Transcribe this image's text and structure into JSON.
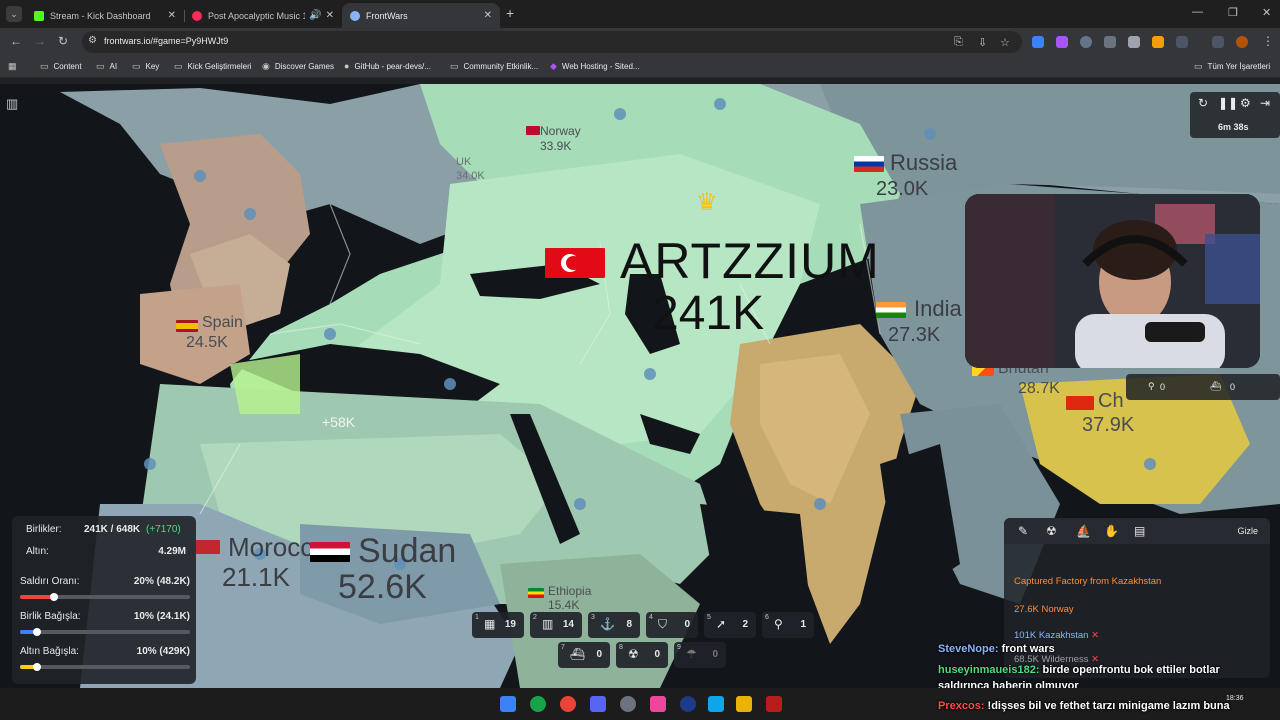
{
  "browser": {
    "tabs": [
      {
        "title": "Stream - Kick Dashboard",
        "color": "#53fc18"
      },
      {
        "title": "Post Apocalyptic Music 10 |",
        "color": "#ff2a55"
      },
      {
        "title": "FrontWars",
        "color": "#8ab4f8"
      }
    ],
    "url": "frontwars.io/#game=Py9HWJt9",
    "bookmarks": [
      {
        "label": "Content",
        "icon": "folder-icon"
      },
      {
        "label": "AI",
        "icon": "folder-icon"
      },
      {
        "label": "Key",
        "icon": "folder-icon"
      },
      {
        "label": "Kick Geliştirmeleri",
        "icon": "folder-icon"
      },
      {
        "label": "Discover Games",
        "icon": "games-icon"
      },
      {
        "label": "GitHub - pear-devs/...",
        "icon": "github-icon"
      },
      {
        "label": "Community Etkinlik...",
        "icon": "folder-icon"
      },
      {
        "label": "Web Hosting - Sited...",
        "icon": "hosting-icon"
      }
    ],
    "other_bookmarks": "Tüm Yer İşaretleri"
  },
  "map": {
    "player": {
      "name": "ARTZZIUM",
      "troops": "241K"
    },
    "countries": [
      {
        "name": "Norway",
        "troops": "33.9K"
      },
      {
        "name": "Russia",
        "troops": "23.0K"
      },
      {
        "name": "Spain",
        "troops": "24.5K"
      },
      {
        "name": "India",
        "troops": "27.3K"
      },
      {
        "name": "Bhutan",
        "troops": "28.7K"
      },
      {
        "name": "Ch",
        "troops": "37.9K"
      },
      {
        "name": "Morocco",
        "troops": "21.1K"
      },
      {
        "name": "Sudan",
        "troops": "52.6K"
      },
      {
        "name": "Ethiopia",
        "troops": "15.4K"
      },
      {
        "name": "UK",
        "troops": "34.0K"
      }
    ],
    "attack_label": "+58K"
  },
  "hud": {
    "timer": "6m 38s",
    "right_counts": [
      "0",
      "0"
    ]
  },
  "stats": {
    "troops_label": "Birlikler:",
    "troops_value": "241K / 648K",
    "troops_delta": "(+7170)",
    "gold_label": "Altın:",
    "gold_value": "4.29M",
    "attack_label": "Saldırı Oranı:",
    "attack_value": "20% (48.2K)",
    "attack_ratio": 0.2,
    "troop_donate_label": "Birlik Bağışla:",
    "troop_donate_value": "10% (24.1K)",
    "troop_donate_ratio": 0.1,
    "gold_donate_label": "Altın Bağışla:",
    "gold_donate_value": "10% (429K)",
    "gold_donate_ratio": 0.1
  },
  "buildings": [
    {
      "key": "1",
      "icon": "city-icon",
      "count": "19"
    },
    {
      "key": "2",
      "icon": "factory-icon",
      "count": "14"
    },
    {
      "key": "3",
      "icon": "port-icon",
      "count": "8"
    },
    {
      "key": "4",
      "icon": "defense-icon",
      "count": "0"
    },
    {
      "key": "5",
      "icon": "missile-silo-icon",
      "count": "2"
    },
    {
      "key": "6",
      "icon": "sam-icon",
      "count": "1"
    },
    {
      "key": "7",
      "icon": "warship-icon",
      "count": "0"
    },
    {
      "key": "8",
      "icon": "nuke-icon",
      "count": "0"
    },
    {
      "key": "9",
      "icon": "mirv-icon",
      "count": "0"
    }
  ],
  "events": {
    "hide_label": "Gizle",
    "items": [
      {
        "text": "Captured Factory from Kazakhstan",
        "color": "#ff8c3a"
      },
      {
        "text": "27.6K Norway",
        "color": "#ff8c3a"
      },
      {
        "text": "101K Kazakhstan",
        "color": "#8ab4f8"
      },
      {
        "text": "68.5K Wilderness",
        "color": "#9aa0a6"
      }
    ]
  },
  "chat": [
    {
      "user": "SteveNope:",
      "msg": " front wars",
      "color": "#8ab4f8"
    },
    {
      "user": "huseyinmaueis182:",
      "msg": " birde openfrontu bok ettiler botlar",
      "color": "#4ade80"
    },
    {
      "user": "",
      "msg": "saldırınca haberin olmuyor",
      "color": "#ffffff"
    },
    {
      "user": "Prexcos:",
      "msg": " !dişses bil ve fethet tarzı minigame lazım buna",
      "color": "#ff4d4d"
    }
  ],
  "taskbar": {
    "time": "18:36"
  }
}
